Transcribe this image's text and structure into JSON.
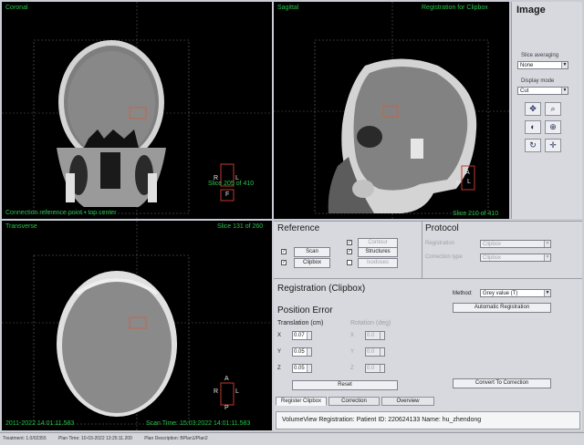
{
  "viewports": {
    "coronal": {
      "name": "Coronal",
      "slice": "Slice 205 of 410",
      "footer": "Connection reference point • top center",
      "marker_letter_r": "R",
      "marker_letter_l": "L",
      "marker_letter_f": "F"
    },
    "sagittal": {
      "name": "Sagittal",
      "title": "Registration for Clipbox",
      "slice": "Slice 210 of 410",
      "marker_letter_a": "A",
      "marker_letter_l": "L",
      "marker_letter_p": "P"
    },
    "transverse": {
      "name": "Transverse",
      "slice": "Slice 131 of 260",
      "footer_left": "2011-2022 14:01:11.583",
      "footer_right": "Scan Time: 15:03:2022 14:01:11.583",
      "marker_letter_a": "A",
      "marker_letter_r": "R",
      "marker_letter_l": "L",
      "marker_letter_p": "P"
    }
  },
  "image_panel": {
    "title": "Image",
    "slice_averaging_label": "Slice averaging",
    "slice_averaging_value": "None",
    "display_mode_label": "Display mode",
    "display_mode_value": "Cut",
    "tools": [
      "pan-icon",
      "zoom-icon",
      "window-level-icon",
      "measure-icon",
      "rotate-icon",
      "crosshair-icon"
    ]
  },
  "reference": {
    "title": "Reference",
    "checkboxes": [
      {
        "label": "Scan",
        "checked": true,
        "enabled": true
      },
      {
        "label": "Contour",
        "checked": true,
        "enabled": false
      },
      {
        "label": "Structures",
        "checked": true,
        "enabled": true
      },
      {
        "label": "Clipbox",
        "checked": true,
        "enabled": true
      },
      {
        "label": "Isodoses",
        "checked": false,
        "enabled": false
      }
    ]
  },
  "protocol": {
    "title": "Protocol",
    "row1_label": "Registration",
    "row1_value": "Clipbox",
    "row2_label": "Correction type",
    "row2_value": "Clipbox"
  },
  "registration": {
    "title": "Registration (Clipbox)",
    "method_label": "Method:",
    "method_value": "Grey value (T)",
    "auto_button": "Automatic Registration",
    "position_error_title": "Position Error",
    "translation_label": "Translation (cm)",
    "rotation_label": "Rotation (deg)",
    "axes": [
      "X",
      "Y",
      "Z"
    ],
    "translation_values": [
      "0.07",
      "0.05",
      "0.05"
    ],
    "rotation_values": [
      "0.0",
      "0.0",
      "0.0"
    ],
    "reset_button": "Reset",
    "convert_button": "Convert To Correction"
  },
  "tabs": [
    "Register Clipbox",
    "Correction",
    "Overview"
  ],
  "status": "VolumeView Registration: Patient ID: 220624133   Name: hu_zhendong",
  "bottom_bar": [
    "Treatment: 1.0/02355",
    "Plan Time: 10-03-2022 13:25:11.200",
    "Plan Description: BPlan1/Plan2"
  ]
}
